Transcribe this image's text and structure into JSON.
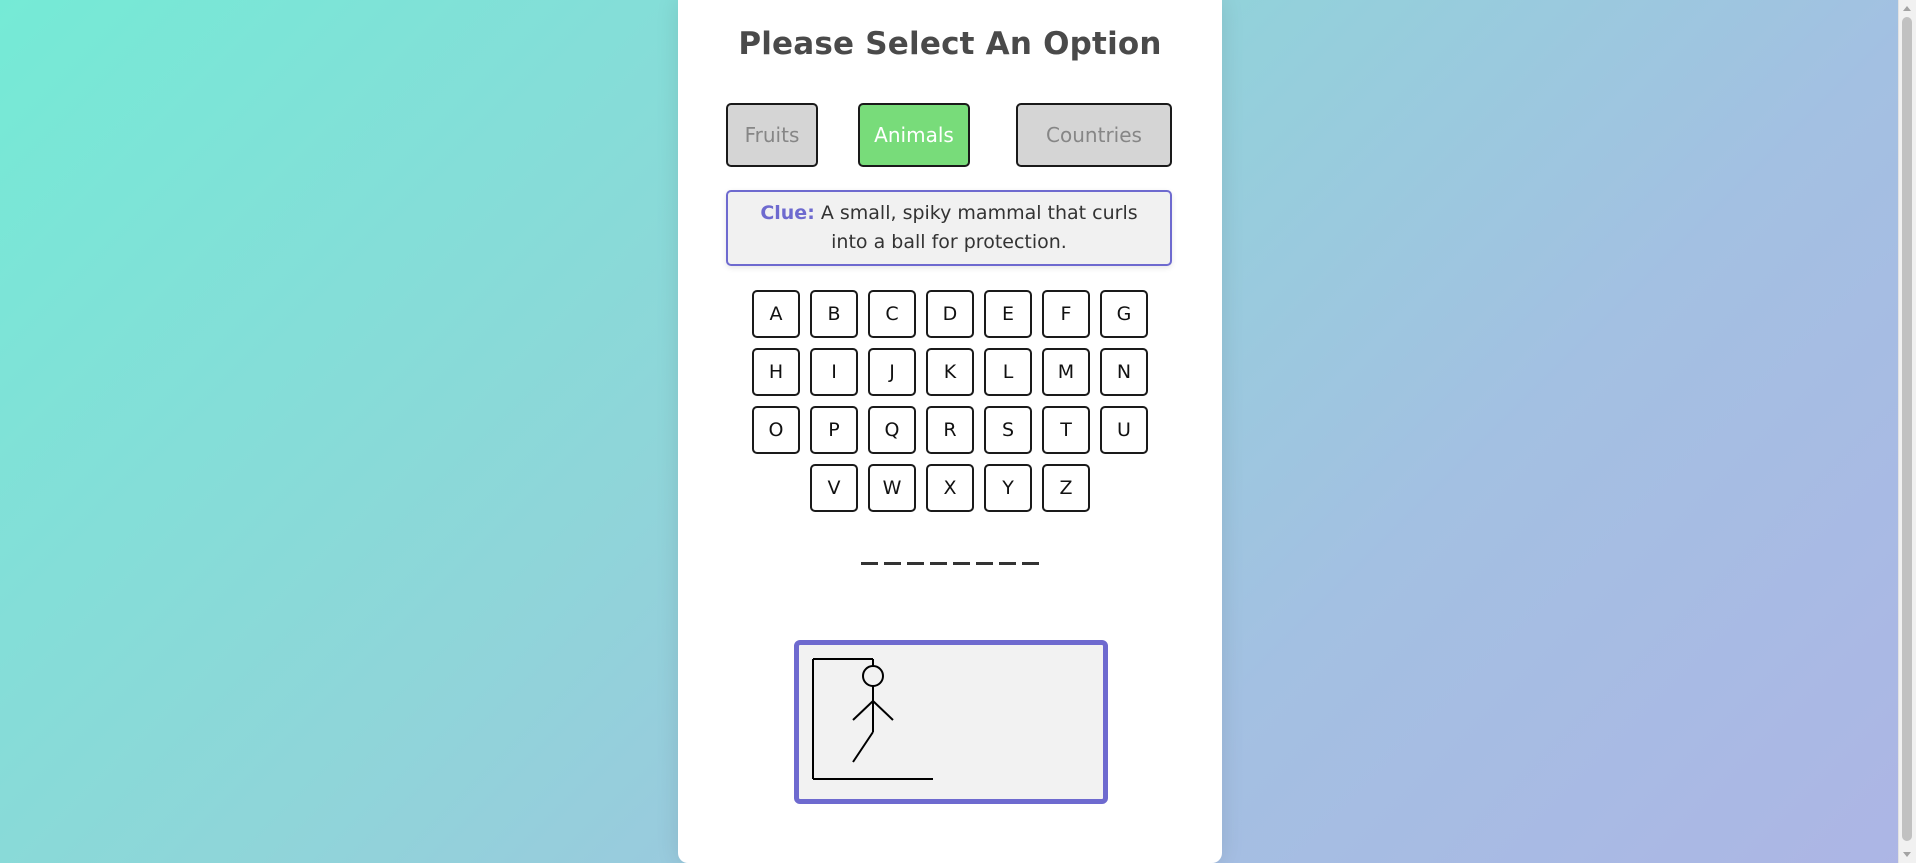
{
  "header": {
    "title": "Please Select An Option"
  },
  "options": [
    {
      "label": "Fruits",
      "active": false
    },
    {
      "label": "Animals",
      "active": true
    },
    {
      "label": "Countries",
      "active": false
    }
  ],
  "clue": {
    "label": "Clue:",
    "text": "A small, spiky mammal that curls into a ball for protection."
  },
  "keyboard": {
    "rows": [
      [
        "A",
        "B",
        "C",
        "D",
        "E",
        "F",
        "G"
      ],
      [
        "H",
        "I",
        "J",
        "K",
        "L",
        "M",
        "N"
      ],
      [
        "O",
        "P",
        "Q",
        "R",
        "S",
        "T",
        "U"
      ],
      [
        "V",
        "W",
        "X",
        "Y",
        "Z"
      ]
    ]
  },
  "word": {
    "blanks": [
      "_",
      "_",
      "_",
      "_",
      "_",
      "_",
      "_",
      "_"
    ]
  },
  "colors": {
    "accent": "#6e6acf",
    "active_option": "#78dc7a",
    "inactive_option": "#d5d5d5"
  }
}
